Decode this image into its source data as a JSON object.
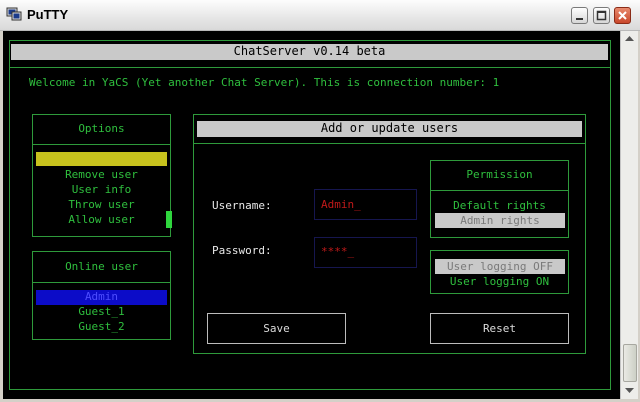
{
  "window": {
    "title": "PuTTY"
  },
  "header_bar": "ChatServer v0.14 beta",
  "welcome": "Welcome in YaCS (Yet another Chat Server). This is connection number: 1",
  "options": {
    "title": "Options",
    "items": [
      "",
      "Remove user",
      "User info",
      "Throw user",
      "Allow user"
    ]
  },
  "online": {
    "title": "Online user",
    "users": [
      "Admin",
      "Guest_1",
      "Guest_2"
    ]
  },
  "dialog": {
    "title": "Add or update users",
    "username_label": "Username:",
    "username_value": "Admin_",
    "password_label": "Password:",
    "password_value": "****_",
    "save_label": "Save",
    "reset_label": "Reset"
  },
  "permission": {
    "title": "Permission",
    "options": [
      "Default rights",
      "Admin rights"
    ],
    "logging": [
      "User logging OFF",
      "User logging ON"
    ]
  },
  "colors": {
    "terminal_bg": "#000000",
    "terminal_text": "#2fbf3e",
    "highlight_yellow": "#c7c21d",
    "highlight_blue": "#0c0cc8",
    "input_red": "#c01919"
  }
}
